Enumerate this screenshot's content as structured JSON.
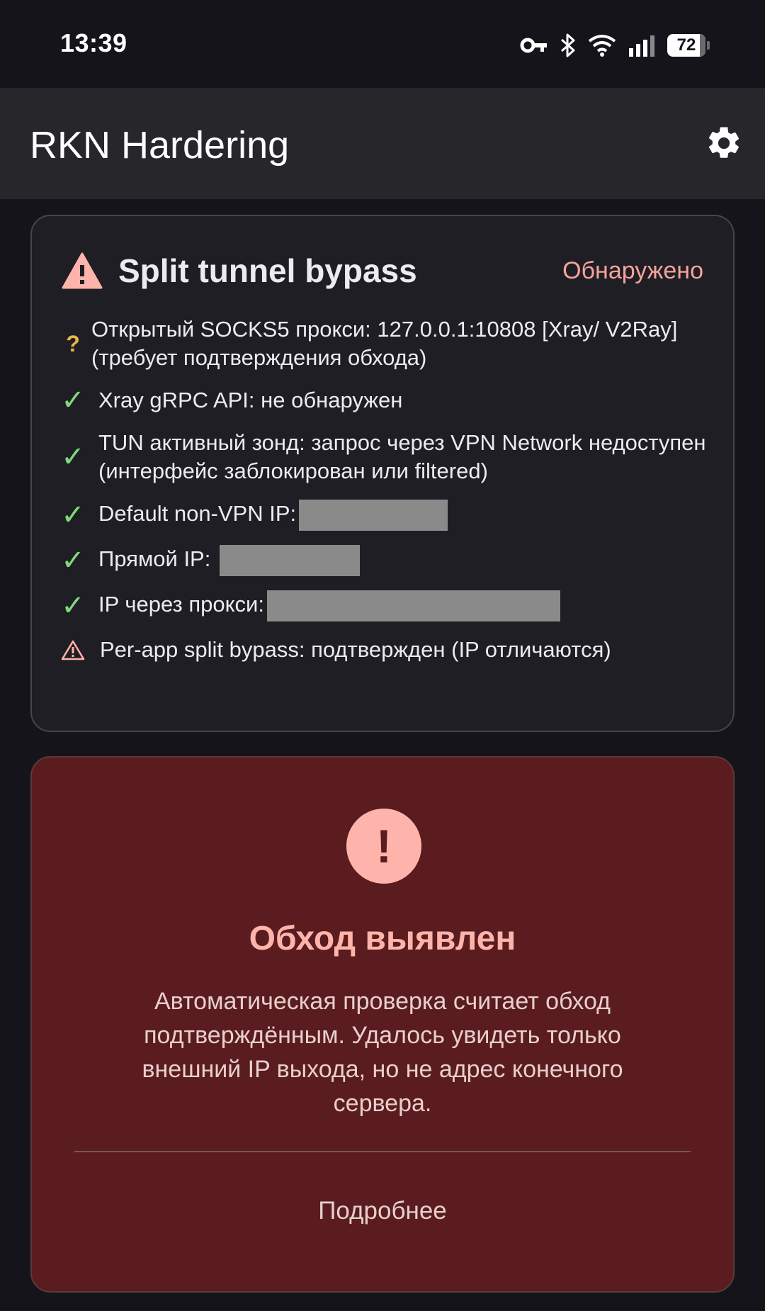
{
  "status_bar": {
    "time": "13:39",
    "battery": "72",
    "icons": [
      "vpn-key-icon",
      "bluetooth-icon",
      "wifi-icon",
      "signal-icon",
      "battery-icon"
    ]
  },
  "app_bar": {
    "title": "RKN Hardering",
    "settings_icon": "gear-icon"
  },
  "check_card": {
    "title": "Split tunnel bypass",
    "status": "Обнаружено",
    "status_color": "#f4a49b",
    "rows": [
      {
        "mark": "?",
        "text": "Открытый SOCKS5 прокси: 127.0.0.1:10808 [Xray/ V2Ray](требует подтверждения обхода)"
      },
      {
        "mark": "✓",
        "text": "Xray gRPC API: не обнаружен"
      },
      {
        "mark": "✓",
        "text": "TUN активный зонд: запрос через VPN Network недоступен (интерфейс заблокирован или filtered)"
      },
      {
        "mark": "✓",
        "text": "Default non-VPN IP:"
      },
      {
        "mark": "✓",
        "text": "Прямой IP:"
      },
      {
        "mark": "✓",
        "text": "IP через прокси:"
      },
      {
        "mark": "⚠",
        "text": "Per-app split bypass: подтвержден (IP отличаются)"
      }
    ]
  },
  "verdict": {
    "icon": "!",
    "title": "Обход выявлен",
    "description": "Автоматическая проверка считает обход подтверждённым. Удалось увидеть только внешний IP выхода, но не адрес конечного сервера.",
    "button": "Подробнее",
    "background": "#5a1c1e",
    "accent": "#ffb4ab"
  }
}
